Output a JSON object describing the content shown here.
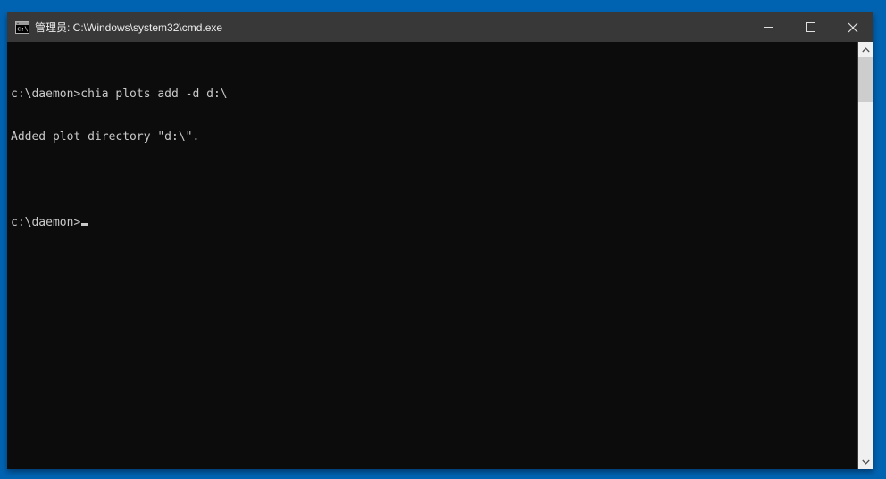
{
  "window": {
    "title": "管理员: C:\\Windows\\system32\\cmd.exe",
    "controls": {
      "minimize": "minimize-icon",
      "maximize": "maximize-icon",
      "close": "close-icon"
    }
  },
  "terminal": {
    "lines": [
      "c:\\daemon>chia plots add -d d:\\",
      "Added plot directory \"d:\\\".",
      "",
      "c:\\daemon>"
    ],
    "cursor_visible": true
  },
  "icons": {
    "app": "cmd-icon",
    "scroll_up": "chevron-up-icon",
    "scroll_down": "chevron-down-icon"
  },
  "colors": {
    "desktop": "#0063b1",
    "titlebar_bg": "#383838",
    "titlebar_fg": "#ececec",
    "terminal_bg": "#0c0c0c",
    "terminal_fg": "#c9c9c9",
    "scrollbar_track": "#f0f0f0",
    "scrollbar_thumb": "#cdcdcd"
  }
}
